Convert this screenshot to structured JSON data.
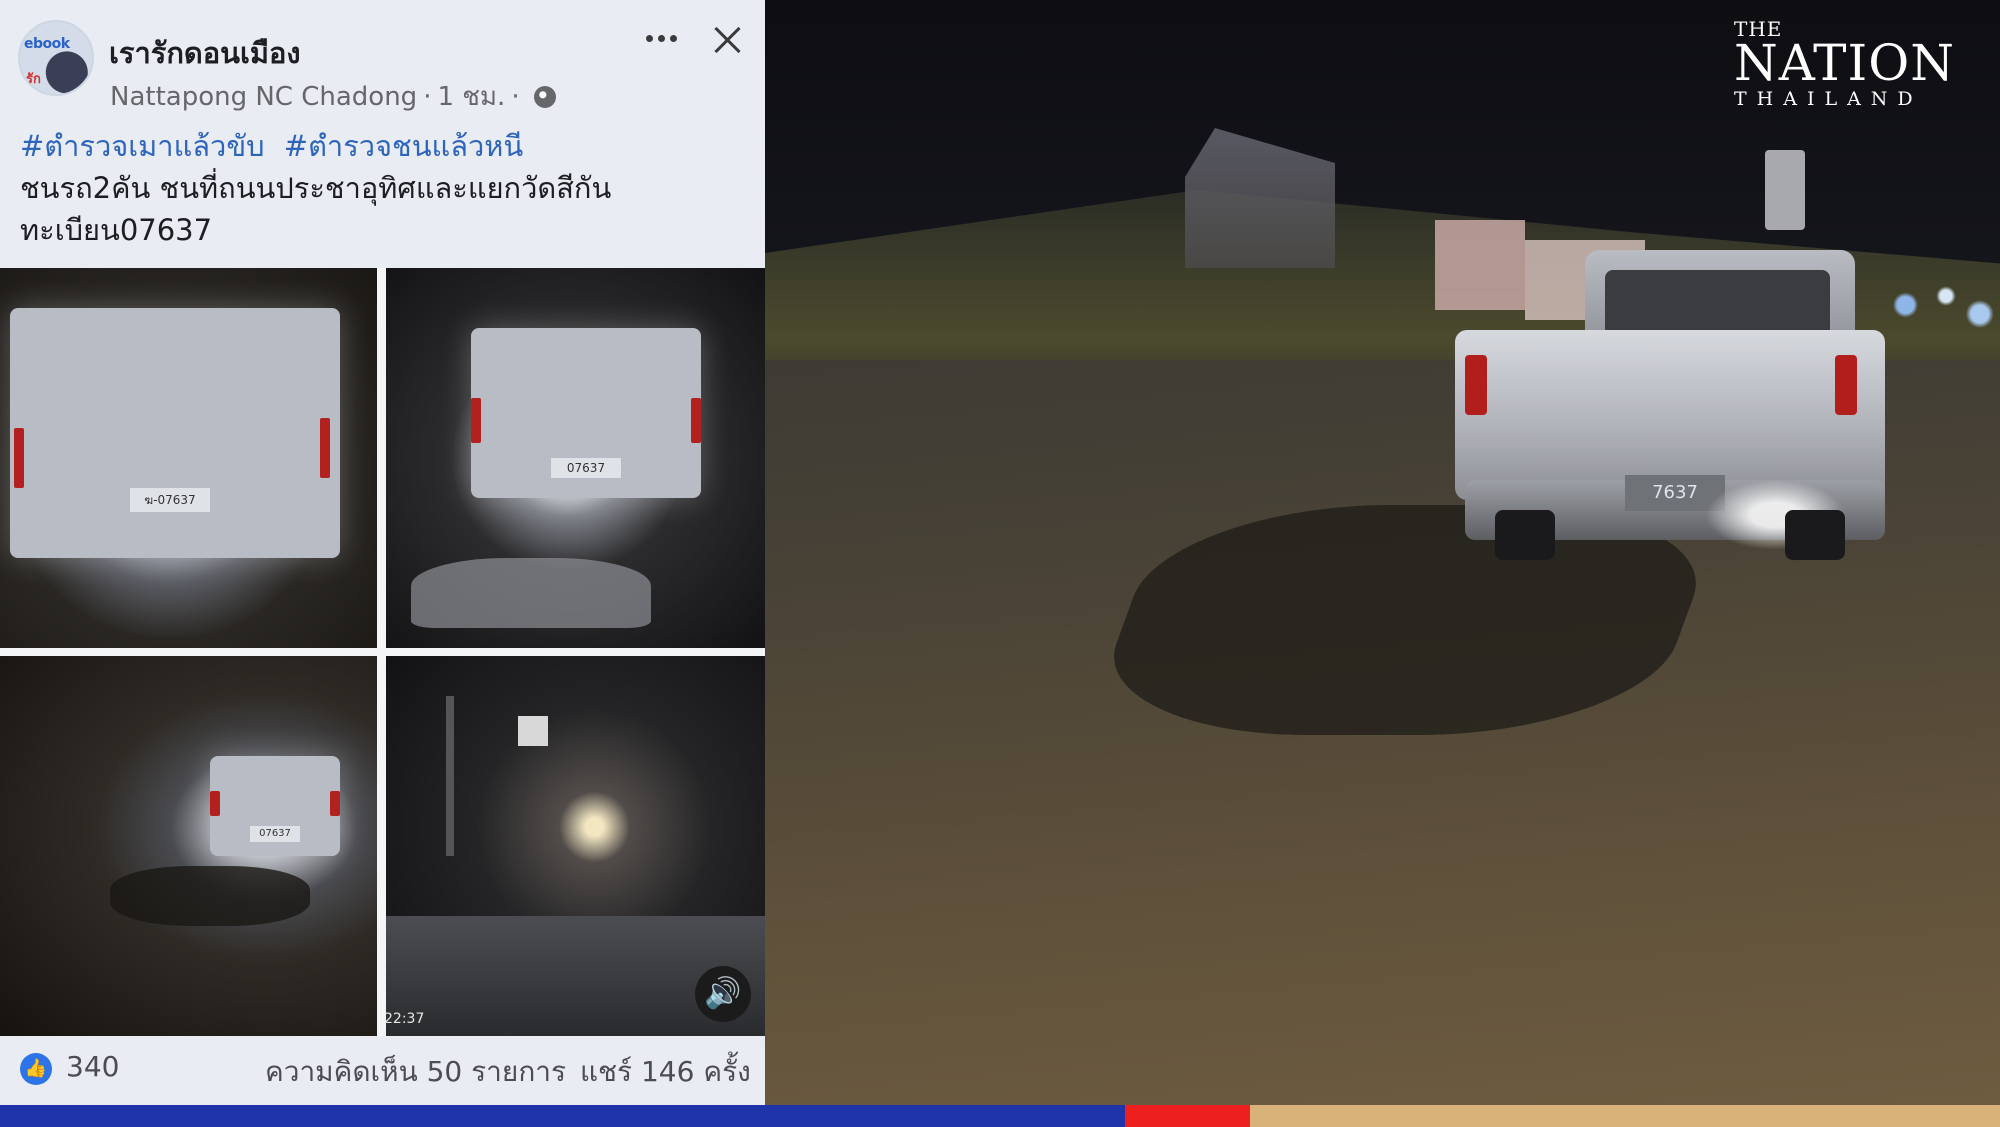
{
  "post": {
    "page_name": "เรารักดอนเมือง",
    "author": "Nattapong NC Chadong",
    "time": "1 ชม.",
    "separator": "·",
    "hashtags": [
      "#ตำรวจเมาแล้วขับ",
      "#ตำรวจชนแล้วหนี"
    ],
    "body_lines": [
      "ชนรถ2คัน ชนที่ถนนประชาอุทิศและแยกวัดสีกัน",
      "ทะเบียน07637"
    ],
    "avatar_text_top": "ebook",
    "avatar_text_bottom": "รัก",
    "video_timestamp": "22:37",
    "plate_1": "ฆ-07637",
    "plate_2": "07637",
    "plate_3": "07637"
  },
  "footer": {
    "likes": "340",
    "comments": "ความคิดเห็น 50 รายการ",
    "shares": "แชร์ 146 ครั้ง"
  },
  "video": {
    "plate": "7637"
  },
  "logo": {
    "the": "THE",
    "nation": "NATION",
    "thailand": "THAILAND"
  },
  "colors": {
    "hashtag": "#2d64bc",
    "like_blue": "#2d74e8",
    "band_blue": "#1f34a8",
    "band_red": "#ee1f1f",
    "band_tan": "#d9b27a"
  },
  "icons": [
    "more-icon",
    "close-icon",
    "globe-icon",
    "like-icon",
    "sound-icon"
  ]
}
